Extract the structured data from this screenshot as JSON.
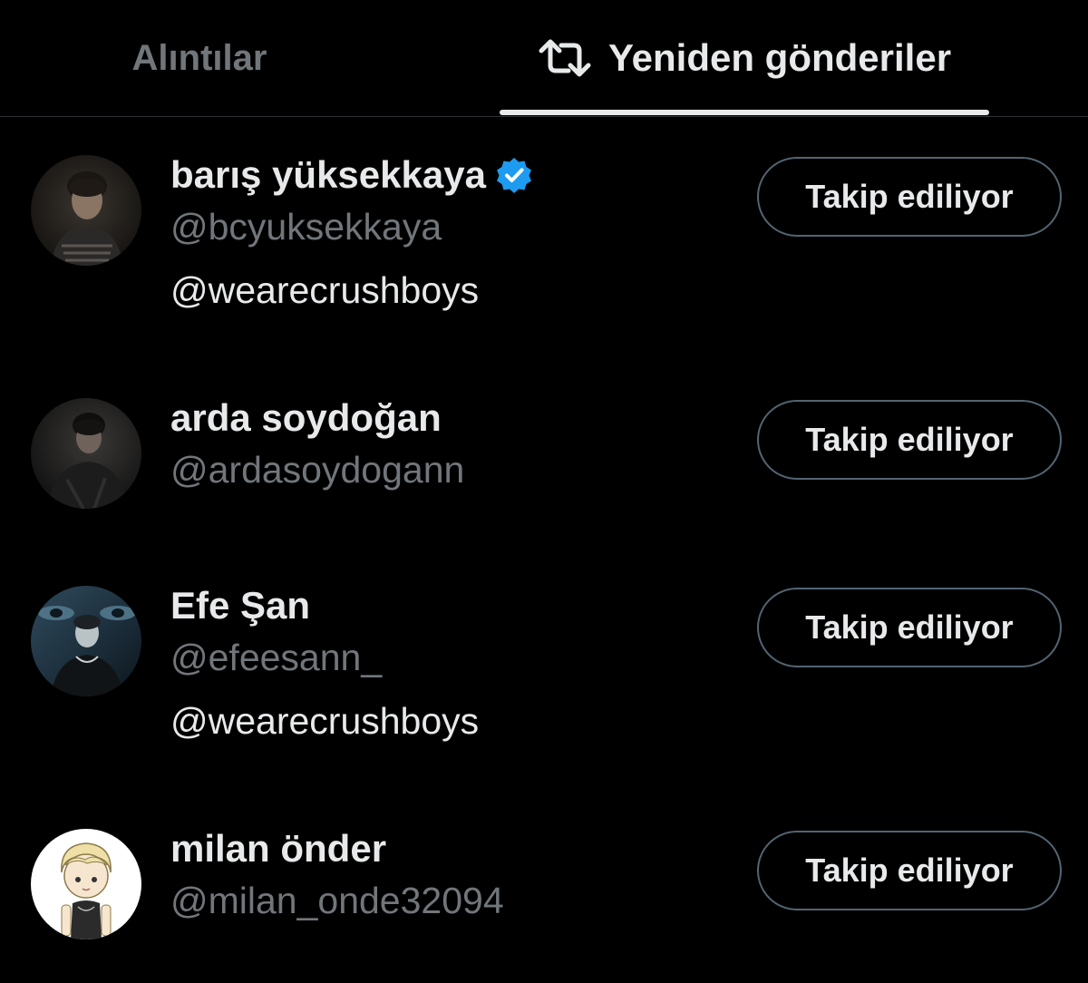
{
  "tabs": {
    "quotes_label": "Alıntılar",
    "reposts_label": "Yeniden gönderiler",
    "active": "reposts"
  },
  "icons": {
    "repost": "repost-icon",
    "verified": "verified-badge-icon"
  },
  "colors": {
    "background": "#000000",
    "text_primary": "#e7e9ea",
    "text_secondary": "#71767b",
    "verified_blue": "#1d9bf0",
    "button_border": "#536471",
    "divider": "#2f3336"
  },
  "users": [
    {
      "display_name": "barış yüksekkaya",
      "verified": true,
      "handle": "@bcyuksekkaya",
      "bio": "@wearecrushboys",
      "follow_label": "Takip ediliyor"
    },
    {
      "display_name": "arda soydoğan",
      "verified": false,
      "handle": "@ardasoydogann",
      "bio": "",
      "follow_label": "Takip ediliyor"
    },
    {
      "display_name": "Efe Şan",
      "verified": false,
      "handle": "@efeesann_",
      "bio": "@wearecrushboys",
      "follow_label": "Takip ediliyor"
    },
    {
      "display_name": "milan önder",
      "verified": false,
      "handle": "@milan_onde32094",
      "bio": "",
      "follow_label": "Takip ediliyor"
    }
  ]
}
